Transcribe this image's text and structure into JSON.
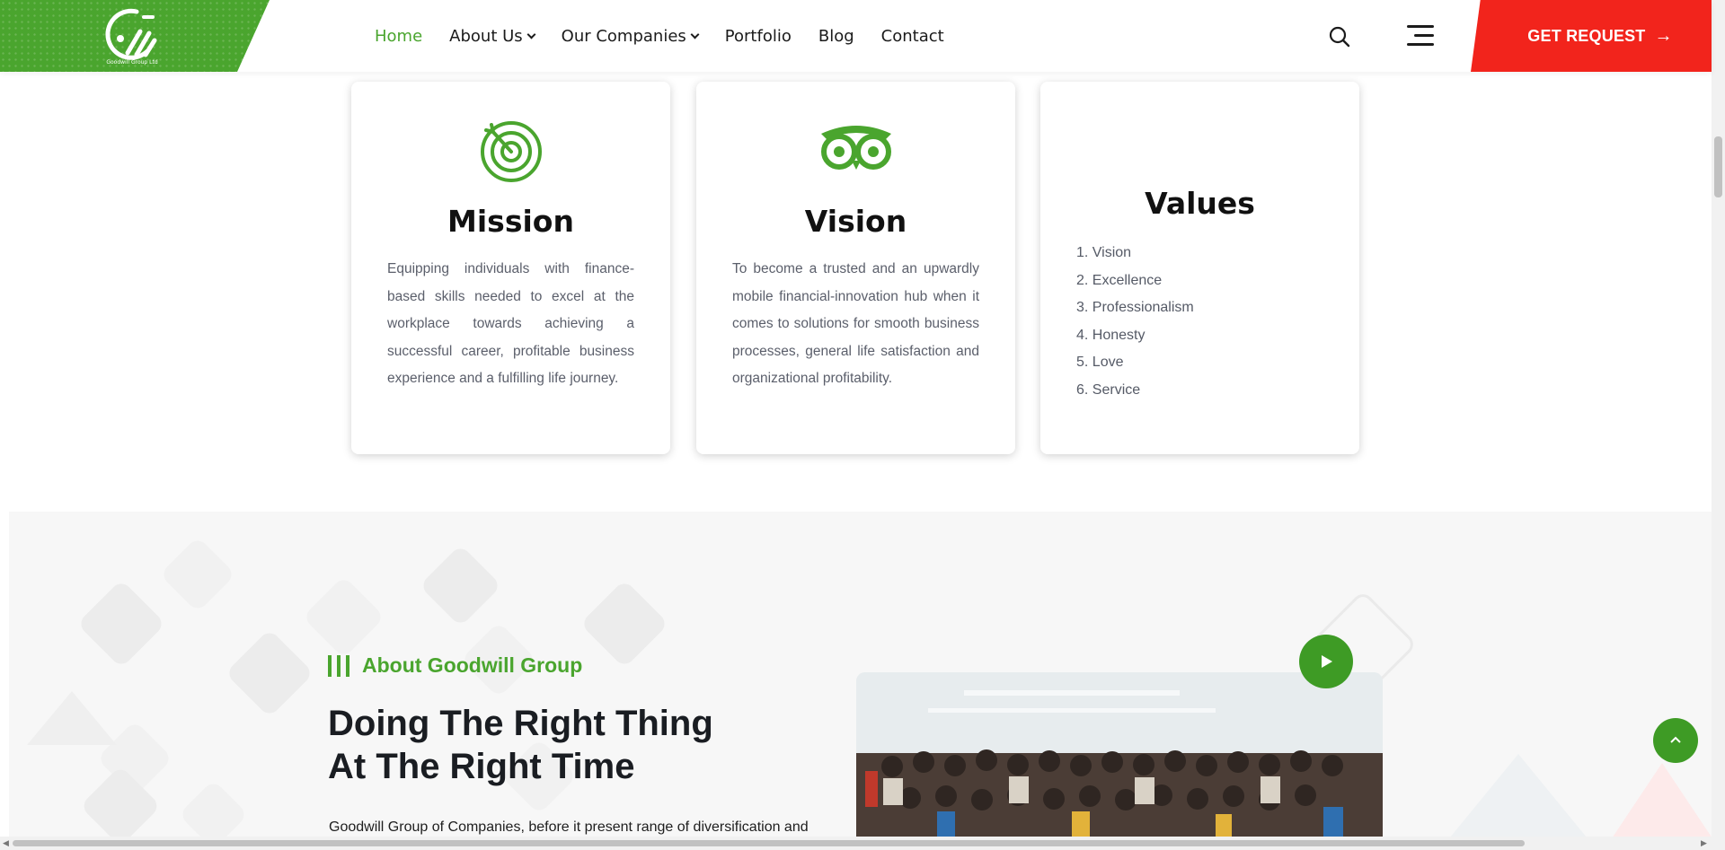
{
  "header": {
    "logo_text": "Goodwill Group Ltd",
    "nav": [
      {
        "label": "Home",
        "active": true,
        "dropdown": false
      },
      {
        "label": "About Us",
        "active": false,
        "dropdown": true
      },
      {
        "label": "Our Companies",
        "active": false,
        "dropdown": true
      },
      {
        "label": "Portfolio",
        "active": false,
        "dropdown": false
      },
      {
        "label": "Blog",
        "active": false,
        "dropdown": false
      },
      {
        "label": "Contact",
        "active": false,
        "dropdown": false
      }
    ],
    "cta_label": "GET REQUEST",
    "icons": {
      "search": "search-icon",
      "menu": "hamburger-menu-icon",
      "cta_arrow": "arrow-right-icon"
    }
  },
  "cards": {
    "mission": {
      "icon": "target-icon",
      "title": "Mission",
      "text": "Equipping individuals with finance-based skills needed to excel at the workplace towards achieving a successful career, profitable business experience and a fulfilling life journey."
    },
    "vision": {
      "icon": "owl-eyes-icon",
      "title": "Vision",
      "text": "To become a trusted and an upwardly mobile financial-innovation hub when it comes to solutions for smooth business processes, general life satisfaction and organizational profitability."
    },
    "values": {
      "title": "Values",
      "items": [
        "1. Vision",
        "2. Excellence",
        "3. Professionalism",
        "4. Honesty",
        "5. Love",
        "6. Service"
      ]
    }
  },
  "about": {
    "tag": "About Goodwill Group",
    "heading": "Doing The Right Thing At The Right Time",
    "text": "Goodwill Group of Companies, before it present range of diversification and",
    "photo_alt": "group-photo",
    "play_icon": "play-icon"
  },
  "scroll_top_icon": "chevron-up-icon",
  "colors": {
    "brand_green": "#4aa52e",
    "cta_red": "#f2241c",
    "section_bg": "#f7f7f7"
  }
}
